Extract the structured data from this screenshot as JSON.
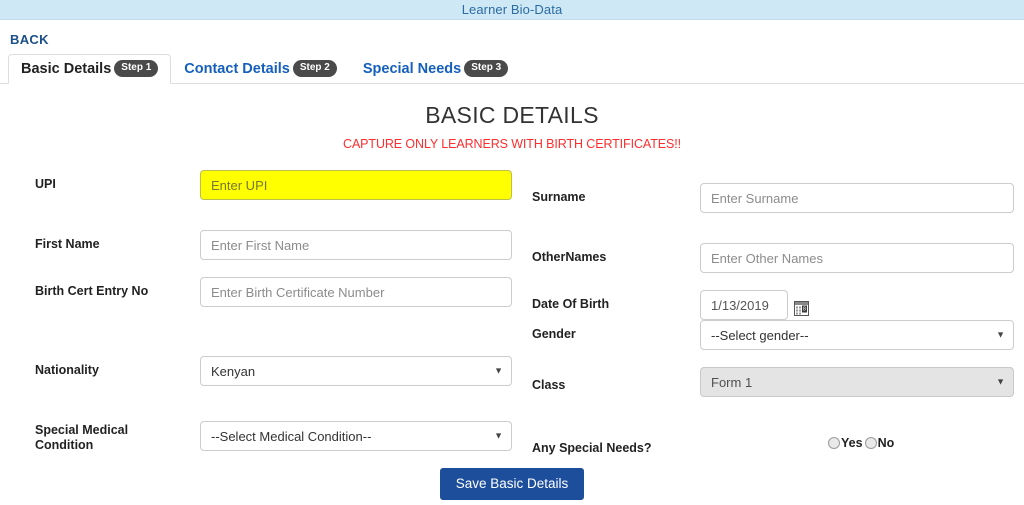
{
  "topbar": {
    "title": "Learner Bio-Data"
  },
  "nav": {
    "back_label": "BACK"
  },
  "tabs": [
    {
      "label": "Basic Details",
      "badge": "Step 1",
      "active": true
    },
    {
      "label": "Contact Details",
      "badge": "Step 2",
      "active": false
    },
    {
      "label": "Special Needs",
      "badge": "Step 3",
      "active": false
    }
  ],
  "heading": {
    "title": "BASIC DETAILS",
    "warning": "CAPTURE ONLY LEARNERS WITH BIRTH CERTIFICATES!!"
  },
  "form": {
    "upi": {
      "label": "UPI",
      "placeholder": "Enter UPI",
      "value": ""
    },
    "first_name": {
      "label": "First Name",
      "placeholder": "Enter First Name",
      "value": ""
    },
    "birth_cert": {
      "label": "Birth Cert Entry No",
      "placeholder": "Enter Birth Certificate Number",
      "value": ""
    },
    "nationality": {
      "label": "Nationality",
      "value": "Kenyan"
    },
    "medical": {
      "label": "Special Medical Condition",
      "value": "--Select Medical Condition--"
    },
    "surname": {
      "label": "Surname",
      "placeholder": "Enter Surname",
      "value": ""
    },
    "othernames": {
      "label": "OtherNames",
      "placeholder": "Enter Other Names",
      "value": ""
    },
    "dob": {
      "label": "Date Of Birth",
      "value": "1/13/2019"
    },
    "gender": {
      "label": "Gender",
      "value": "--Select gender--"
    },
    "class": {
      "label": "Class",
      "value": "Form 1"
    },
    "special_needs": {
      "label": "Any Special Needs?",
      "yes_label": "Yes",
      "no_label": "No"
    }
  },
  "actions": {
    "save_label": "Save Basic Details"
  },
  "colors": {
    "topbar_bg": "#cfe8f5",
    "link": "#1560bd",
    "warning": "#ff2d2d",
    "highlight": "#ffff00",
    "primary": "#1c4e9c"
  }
}
